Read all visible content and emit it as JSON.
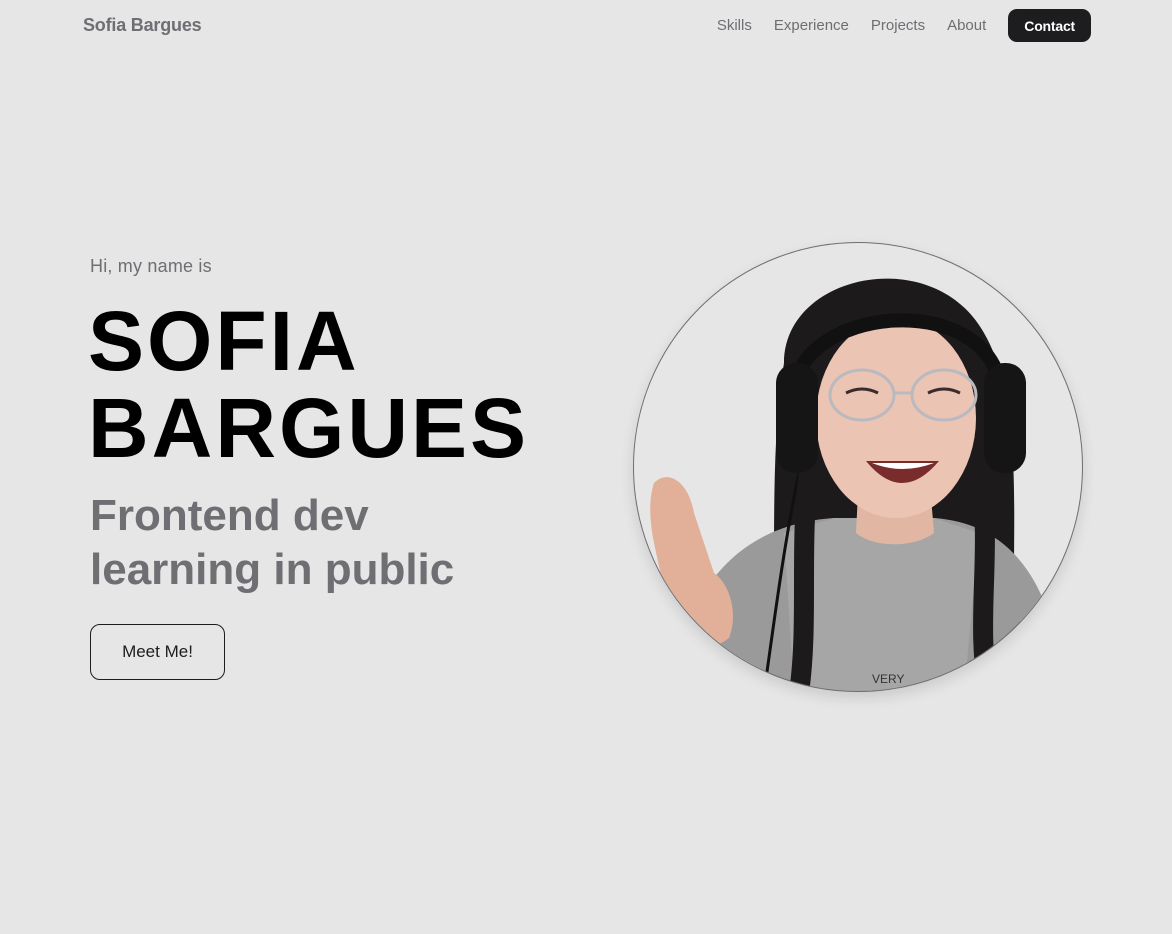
{
  "nav": {
    "brand": "Sofia Bargues",
    "links": [
      {
        "label": "Skills"
      },
      {
        "label": "Experience"
      },
      {
        "label": "Projects"
      },
      {
        "label": "About"
      }
    ],
    "contact_label": "Contact"
  },
  "hero": {
    "greeting": "Hi, my name is",
    "name_line1": "SOFIA",
    "name_line2": "BARGUES",
    "subtitle_line1": "Frontend dev",
    "subtitle_line2": "learning in public",
    "cta_label": "Meet Me!"
  },
  "portrait": {
    "shirt_text": "VERY"
  },
  "colors": {
    "background": "#e6e6e6",
    "text_muted": "#6e6e73",
    "text_strong": "#000000",
    "button_dark": "#1d1d1f",
    "button_dark_text": "#ffffff"
  }
}
